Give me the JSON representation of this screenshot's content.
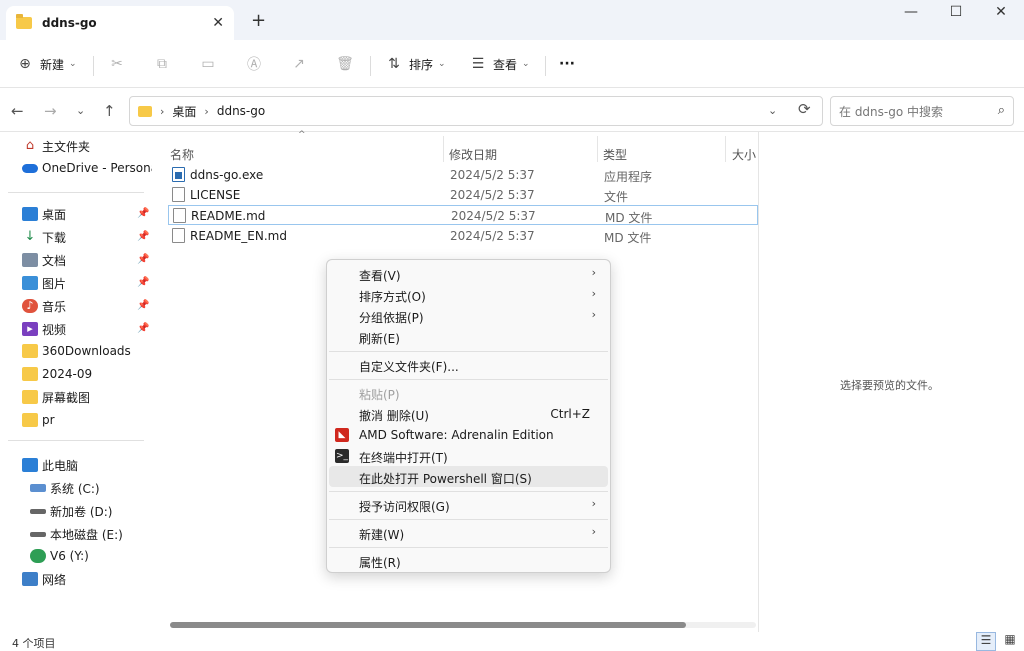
{
  "window": {
    "tab_title": "ddns-go",
    "tab_close": "✕",
    "new_tab": "+",
    "minimize": "—",
    "maximize": "☐",
    "close": "✕"
  },
  "toolbar": {
    "new_label": "新建",
    "sort_label": "排序",
    "view_label": "查看",
    "more": "···"
  },
  "address": {
    "crumbs": [
      "桌面",
      "ddns-go"
    ],
    "search_placeholder": "在 ddns-go 中搜索"
  },
  "sidebar": {
    "items": [
      {
        "label": "主文件夹"
      },
      {
        "label": "OneDrive - Personal"
      },
      {
        "label": "桌面"
      },
      {
        "label": "下载"
      },
      {
        "label": "文档"
      },
      {
        "label": "图片"
      },
      {
        "label": "音乐"
      },
      {
        "label": "视频"
      },
      {
        "label": "360Downloads"
      },
      {
        "label": "2024-09"
      },
      {
        "label": "屏幕截图"
      },
      {
        "label": "pr"
      },
      {
        "label": "此电脑"
      },
      {
        "label": "系统 (C:)"
      },
      {
        "label": "新加卷 (D:)"
      },
      {
        "label": "本地磁盘 (E:)"
      },
      {
        "label": "V6 (Y:)"
      },
      {
        "label": "网络"
      }
    ]
  },
  "columns": {
    "name": "名称",
    "date": "修改日期",
    "type": "类型",
    "size": "大小"
  },
  "files": [
    {
      "name": "ddns-go.exe",
      "date": "2024/5/2 5:37",
      "type": "应用程序"
    },
    {
      "name": "LICENSE",
      "date": "2024/5/2 5:37",
      "type": "文件"
    },
    {
      "name": "README.md",
      "date": "2024/5/2 5:37",
      "type": "MD 文件"
    },
    {
      "name": "README_EN.md",
      "date": "2024/5/2 5:37",
      "type": "MD 文件"
    }
  ],
  "preview": {
    "text": "选择要预览的文件。"
  },
  "status": {
    "count": "4 个项目"
  },
  "context_menu": {
    "view": "查看(V)",
    "sort": "排序方式(O)",
    "group": "分组依据(P)",
    "refresh": "刷新(E)",
    "customize": "自定义文件夹(F)...",
    "paste": "粘贴(P)",
    "undo": "撤消 删除(U)",
    "undo_shortcut": "Ctrl+Z",
    "amd": "AMD Software: Adrenalin Edition",
    "terminal": "在终端中打开(T)",
    "powershell": "在此处打开 Powershell 窗口(S)",
    "access": "授予访问权限(G)",
    "new": "新建(W)",
    "properties": "属性(R)"
  }
}
